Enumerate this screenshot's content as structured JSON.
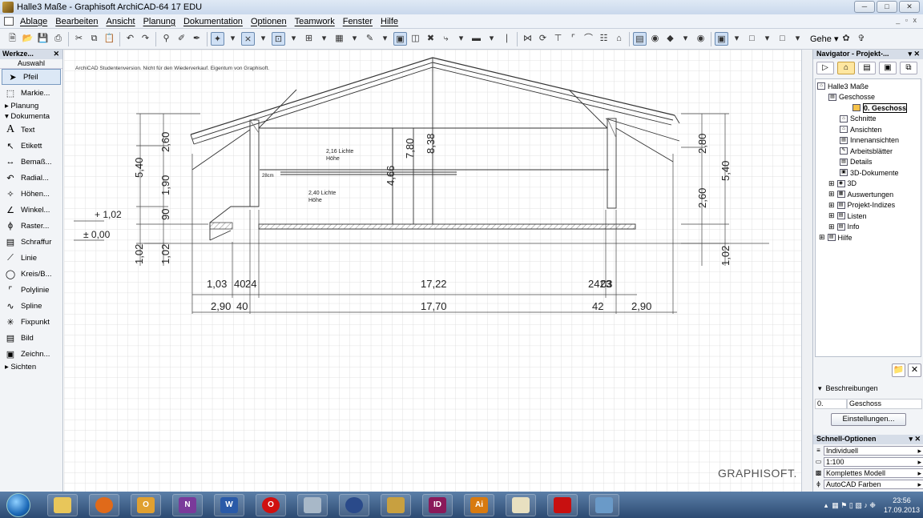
{
  "window": {
    "title": "Halle3 Maße - Graphisoft ArchiCAD-64 17 EDU"
  },
  "menu": [
    "Ablage",
    "Bearbeiten",
    "Ansicht",
    "Planung",
    "Dokumentation",
    "Optionen",
    "Teamwork",
    "Fenster",
    "Hilfe"
  ],
  "toolbar": {
    "gehe_label": "Gehe"
  },
  "toolbox": {
    "title": "Werkze...",
    "auswahl": "Auswahl",
    "tools_top": [
      {
        "label": "Pfeil",
        "icon": "arrow-icon"
      },
      {
        "label": "Markie...",
        "icon": "marquee-icon"
      }
    ],
    "section_planung": "Planung",
    "section_dokumenta": "Dokumenta",
    "tools_doc": [
      {
        "label": "Text",
        "icon": "text-icon"
      },
      {
        "label": "Etikett",
        "icon": "label-icon"
      },
      {
        "label": "Bemaß...",
        "icon": "dimension-icon"
      },
      {
        "label": "Radial...",
        "icon": "radial-dimension-icon"
      },
      {
        "label": "Höhen...",
        "icon": "level-dimension-icon"
      },
      {
        "label": "Winkel...",
        "icon": "angle-dimension-icon"
      },
      {
        "label": "Raster...",
        "icon": "grid-icon"
      },
      {
        "label": "Schraffur",
        "icon": "fill-icon"
      },
      {
        "label": "Linie",
        "icon": "line-icon"
      },
      {
        "label": "Kreis/B...",
        "icon": "circle-icon"
      },
      {
        "label": "Polylinie",
        "icon": "polyline-icon"
      },
      {
        "label": "Spline",
        "icon": "spline-icon"
      },
      {
        "label": "Fixpunkt",
        "icon": "hotspot-icon"
      },
      {
        "label": "Bild",
        "icon": "picture-icon"
      },
      {
        "label": "Zeichn...",
        "icon": "drawing-icon"
      }
    ],
    "section_sichten": "Sichten"
  },
  "drawing": {
    "watermark": "ArchiCAD Studentenversion. Nicht für den Wiederverkauf. Eigentum von Graphisoft.",
    "level_labels": [
      "+ 1,02",
      "± 0,00"
    ],
    "room_labels": [
      [
        "2,16 Lichte",
        "Höhe"
      ],
      [
        "2,40 Lichte",
        "Höhe"
      ]
    ],
    "small_label": "28cm",
    "left_dims": [
      "5,40",
      "2,60",
      "1,90",
      "90",
      "1,02",
      "1,02"
    ],
    "right_dims": [
      "2,80",
      "5,40",
      "2,60",
      "1,02"
    ],
    "center_dims": [
      "7,80",
      "8,38",
      "4,66"
    ],
    "bottom_row1": [
      "1,03",
      "40",
      "24",
      "17,22",
      "2423",
      "03"
    ],
    "bottom_row2": [
      "2,90",
      "40",
      "17,70",
      "42",
      "2,90"
    ],
    "brand": "GRAPHISOFT."
  },
  "navigator": {
    "title": "Navigator - Projekt-...",
    "tree": [
      {
        "label": "Halle3 Maße",
        "indent": 0
      },
      {
        "label": "Geschosse",
        "indent": 1
      },
      {
        "label": "0. Geschoss",
        "indent": 2,
        "selected": true
      },
      {
        "label": "Schnitte",
        "indent": 1
      },
      {
        "label": "Ansichten",
        "indent": 1
      },
      {
        "label": "Innenansichten",
        "indent": 1
      },
      {
        "label": "Arbeitsblätter",
        "indent": 1
      },
      {
        "label": "Details",
        "indent": 1
      },
      {
        "label": "3D-Dokumente",
        "indent": 1
      },
      {
        "label": "3D",
        "indent": 1
      },
      {
        "label": "Auswertungen",
        "indent": 1
      },
      {
        "label": "Projekt-Indizes",
        "indent": 1
      },
      {
        "label": "Listen",
        "indent": 1
      },
      {
        "label": "Info",
        "indent": 1
      },
      {
        "label": "Hilfe",
        "indent": 0
      }
    ],
    "beschreibungen": "Beschreibungen",
    "layer_id": "0.",
    "layer_name": "Geschoss",
    "einstellungen": "Einstellungen..."
  },
  "schnell": {
    "title": "Schnell-Optionen",
    "options": [
      "Individuell",
      "1:100",
      "Komplettes Modell",
      "AutoCAD Farben"
    ]
  },
  "taskbar": {
    "apps": [
      "explorer-icon",
      "firefox-icon",
      "outlook-icon",
      "onenote-icon",
      "word-icon",
      "opera-icon",
      "calculator-icon",
      "keepass-icon",
      "archicad-icon",
      "indesign-icon",
      "illustrator-icon",
      "notepad-icon",
      "autocad-icon",
      "remote-icon"
    ],
    "indesign_text": "ID",
    "illustrator_text": "Ai",
    "time": "23:56",
    "date": "17.09.2013"
  }
}
